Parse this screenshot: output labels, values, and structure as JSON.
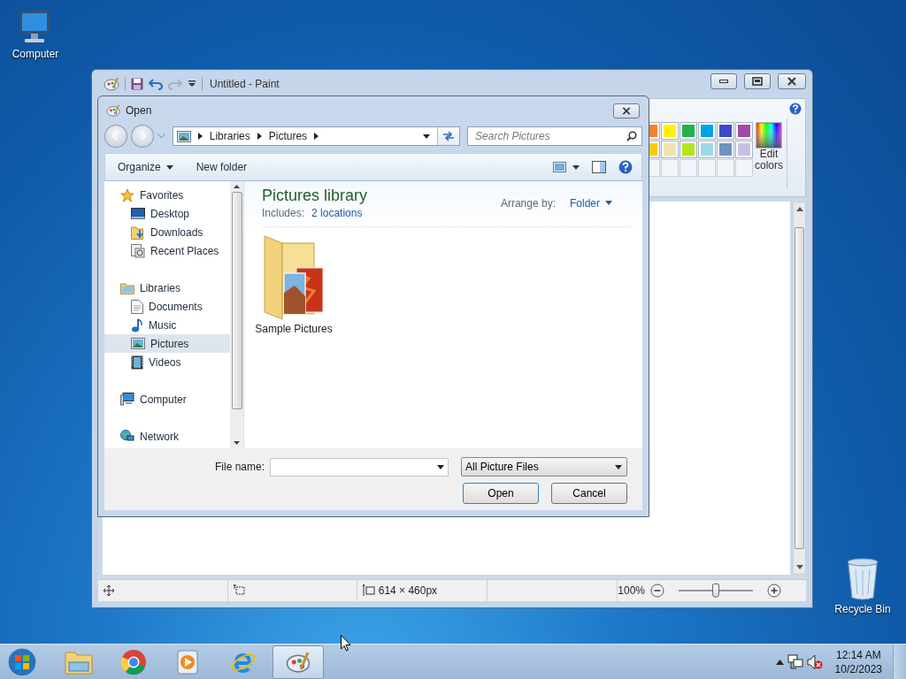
{
  "desktop_icons": [
    {
      "label": "Computer",
      "kind": "computer"
    },
    {
      "label": "Recycle Bin",
      "kind": "recycle"
    }
  ],
  "paint": {
    "title": "Untitled - Paint",
    "palette": [
      {
        "kind": "color",
        "color": "#ff7f27"
      },
      {
        "kind": "color",
        "color": "#fff200"
      },
      {
        "kind": "color",
        "color": "#22b14c"
      },
      {
        "kind": "color",
        "color": "#00a2e8"
      },
      {
        "kind": "color",
        "color": "#3f48cc"
      },
      {
        "kind": "color",
        "color": "#a349a4"
      },
      {
        "kind": "color",
        "color": "#ffc90e"
      },
      {
        "kind": "color",
        "color": "#efe4b0"
      },
      {
        "kind": "color",
        "color": "#b5e61d"
      },
      {
        "kind": "color",
        "color": "#99d9ea"
      },
      {
        "kind": "color",
        "color": "#7092be"
      },
      {
        "kind": "color",
        "color": "#c8bfe7"
      },
      {
        "kind": "empty"
      },
      {
        "kind": "empty"
      },
      {
        "kind": "empty"
      },
      {
        "kind": "empty"
      },
      {
        "kind": "empty"
      },
      {
        "kind": "empty"
      }
    ],
    "edit_colors": "Edit colors",
    "status": {
      "dimensions": "614 × 460px",
      "zoom": "100%"
    },
    "zoom_slider": {
      "level": 0.5
    }
  },
  "dialog": {
    "title": "Open",
    "breadcrumb": [
      "Libraries",
      "Pictures"
    ],
    "search": {
      "placeholder": "Search Pictures"
    },
    "toolbar": {
      "organize": "Organize",
      "new_folder": "New folder"
    },
    "nav": [
      {
        "label": "Favorites",
        "kind": "star",
        "selected": false,
        "children": [
          {
            "label": "Desktop",
            "kind": "desktop",
            "selected": false
          },
          {
            "label": "Downloads",
            "kind": "downloads",
            "selected": false
          },
          {
            "label": "Recent Places",
            "kind": "recent",
            "selected": false
          }
        ]
      },
      {
        "label": "Libraries",
        "kind": "libraries",
        "selected": false,
        "children": [
          {
            "label": "Documents",
            "kind": "documents",
            "selected": false
          },
          {
            "label": "Music",
            "kind": "music",
            "selected": false
          },
          {
            "label": "Pictures",
            "kind": "pictures",
            "selected": true
          },
          {
            "label": "Videos",
            "kind": "videos",
            "selected": false
          }
        ]
      },
      {
        "label": "Computer",
        "kind": "computer",
        "selected": false
      },
      {
        "label": "Network",
        "kind": "network",
        "selected": false
      }
    ],
    "library": {
      "title": "Pictures library",
      "includes_label": "Includes:",
      "includes_link": "2 locations",
      "arrange_label": "Arrange by:",
      "arrange_value": "Folder"
    },
    "items": [
      {
        "label": "Sample Pictures"
      }
    ],
    "file_name_label": "File name:",
    "filter": "All Picture Files",
    "buttons": [
      {
        "label": "Open",
        "kind": "primary"
      },
      {
        "label": "Cancel",
        "kind": "normal"
      }
    ]
  },
  "taskbar": {
    "apps": [
      {
        "kind": "explorer",
        "selected": false
      },
      {
        "kind": "chrome",
        "selected": false
      },
      {
        "kind": "media",
        "selected": false
      },
      {
        "kind": "ie",
        "selected": false
      },
      {
        "kind": "paint",
        "selected": true
      }
    ],
    "clock": {
      "time": "12:14 AM",
      "date": "10/2/2023"
    }
  }
}
